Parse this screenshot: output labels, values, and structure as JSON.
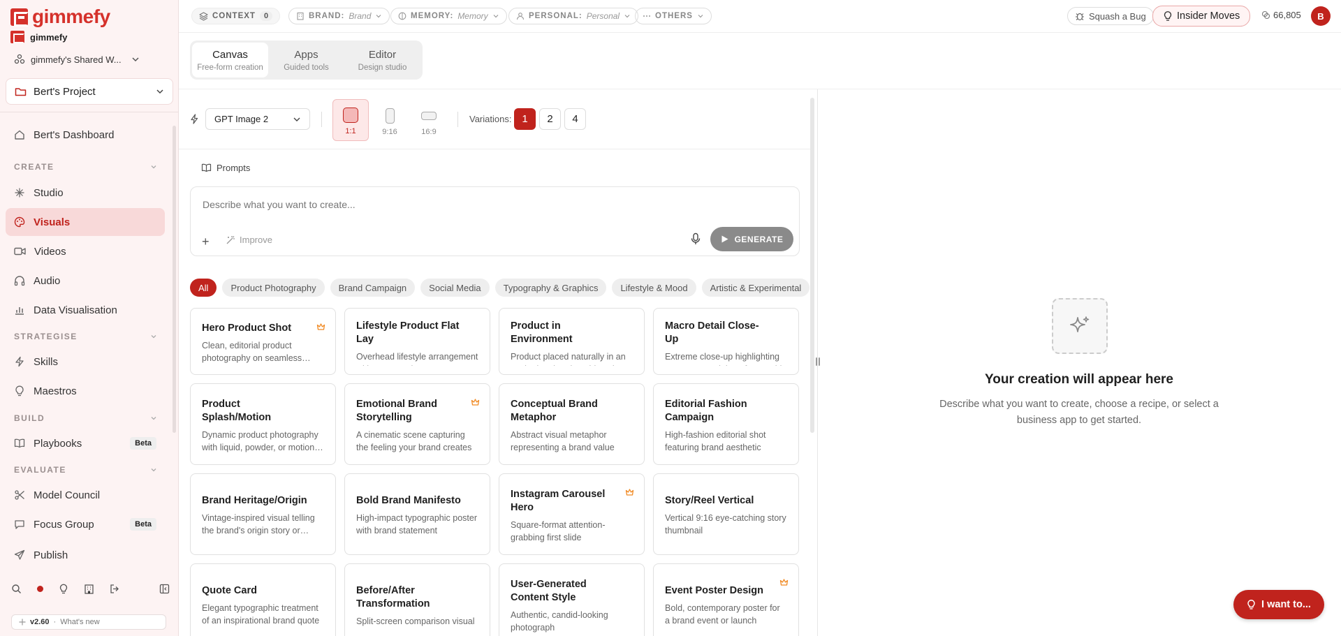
{
  "app": {
    "logo_text": "gimmefy",
    "org_name": "gimmefy",
    "workspace": "gimmefy's Shared W...",
    "project": "Bert's Project"
  },
  "sidebar": {
    "dashboard": "Bert's Dashboard",
    "sections": {
      "create": "CREATE",
      "strategise": "STRATEGISE",
      "build": "BUILD",
      "evaluate": "EVALUATE"
    },
    "items": {
      "studio": "Studio",
      "visuals": "Visuals",
      "videos": "Videos",
      "audio": "Audio",
      "data_vis": "Data Visualisation",
      "skills": "Skills",
      "maestros": "Maestros",
      "playbooks": "Playbooks",
      "model_council": "Model Council",
      "focus_group": "Focus Group",
      "publish": "Publish"
    },
    "beta_label": "Beta",
    "version": "v2.60",
    "whats_new": "What's new"
  },
  "topbar": {
    "context_label": "CONTEXT",
    "context_count": "0",
    "brand_label": "BRAND:",
    "brand_value": "Brand",
    "memory_label": "MEMORY:",
    "memory_value": "Memory",
    "personal_label": "PERSONAL:",
    "personal_value": "Personal",
    "others_label": "OTHERS",
    "squash": "Squash a Bug",
    "insider": "Insider Moves",
    "credits": "66,805",
    "avatar": "B"
  },
  "modes": [
    {
      "title": "Canvas",
      "sub": "Free-form creation"
    },
    {
      "title": "Apps",
      "sub": "Guided tools"
    },
    {
      "title": "Editor",
      "sub": "Design studio"
    }
  ],
  "controls": {
    "model": "GPT Image 2",
    "ratios": [
      "1:1",
      "9:16",
      "16:9"
    ],
    "variations_label": "Variations:",
    "variations": [
      "1",
      "2",
      "4"
    ]
  },
  "prompt": {
    "prompts_link": "Prompts",
    "placeholder": "Describe what you want to create...",
    "improve": "Improve",
    "generate": "GENERATE"
  },
  "filters": [
    "All",
    "Product Photography",
    "Brand Campaign",
    "Social Media",
    "Typography & Graphics",
    "Lifestyle & Mood",
    "Artistic & Experimental"
  ],
  "recipes": [
    {
      "title": "Hero Product Shot",
      "desc": "Clean, editorial product photography on seamless backgrounds"
    },
    {
      "title": "Lifestyle Product Flat Lay",
      "desc": "Overhead lifestyle arrangement with props and context"
    },
    {
      "title": "Product in Environment",
      "desc": "Product placed naturally in an aspirational real-world setting"
    },
    {
      "title": "Macro Detail Close-Up",
      "desc": "Extreme close-up highlighting texture, material, craftsmanship"
    },
    {
      "title": "Product Splash/Motion",
      "desc": "Dynamic product photography with liquid, powder, or motion effects"
    },
    {
      "title": "Emotional Brand Storytelling",
      "desc": "A cinematic scene capturing the feeling your brand creates"
    },
    {
      "title": "Conceptual Brand Metaphor",
      "desc": "Abstract visual metaphor representing a brand value"
    },
    {
      "title": "Editorial Fashion Campaign",
      "desc": "High-fashion editorial shot featuring brand aesthetic"
    },
    {
      "title": "Brand Heritage/Origin",
      "desc": "Vintage-inspired visual telling the brand's origin story or legacy"
    },
    {
      "title": "Bold Brand Manifesto",
      "desc": "High-impact typographic poster with brand statement"
    },
    {
      "title": "Instagram Carousel Hero",
      "desc": "Square-format attention-grabbing first slide"
    },
    {
      "title": "Story/Reel Vertical",
      "desc": "Vertical 9:16 eye-catching story thumbnail"
    },
    {
      "title": "Quote Card",
      "desc": "Elegant typographic treatment of an inspirational brand quote"
    },
    {
      "title": "Before/After Transformation",
      "desc": "Split-screen comparison visual"
    },
    {
      "title": "User-Generated Content Style",
      "desc": "Authentic, candid-looking photograph"
    },
    {
      "title": "Event Poster Design",
      "desc": "Bold, contemporary poster for a brand event or launch"
    }
  ],
  "preview": {
    "title": "Your creation will appear here",
    "desc": "Describe what you want to create, choose a recipe, or select a business app to get started."
  },
  "fab": "I want to...",
  "colors": {
    "accent": "#c0231d",
    "brand": "#d5312b",
    "sidebar_bg": "#fdf3f3",
    "premium": "#f08a24"
  },
  "icons": {
    "premium": "crown-icon",
    "sparkle": "sparkle-icon"
  }
}
